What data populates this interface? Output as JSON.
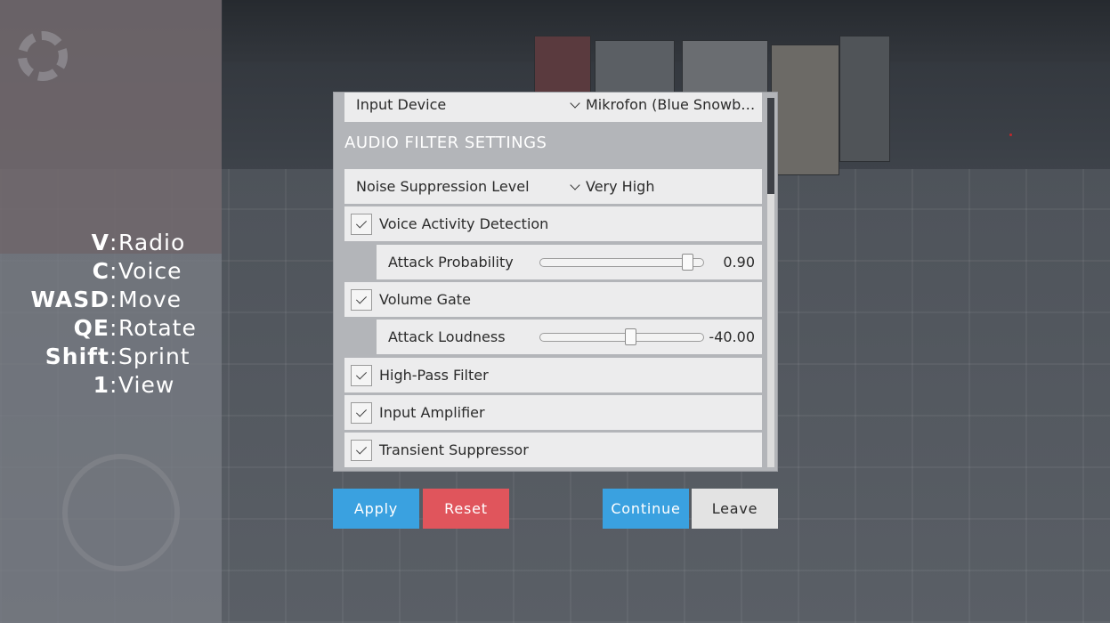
{
  "keybinds": [
    {
      "key": "V",
      "action": "Radio"
    },
    {
      "key": "C",
      "action": "Voice"
    },
    {
      "key": "WASD",
      "action": "Move"
    },
    {
      "key": "QE",
      "action": "Rotate"
    },
    {
      "key": "Shift",
      "action": "Sprint"
    },
    {
      "key": "1",
      "action": "View"
    }
  ],
  "settings": {
    "input_device": {
      "label": "Input Device",
      "value": "Mikrofon (Blue Snowb…"
    },
    "section_title": "AUDIO FILTER SETTINGS",
    "noise_suppression": {
      "label": "Noise Suppression Level",
      "value": "Very High"
    },
    "voice_activity_detection": {
      "label": "Voice Activity Detection",
      "checked": true
    },
    "attack_probability": {
      "label": "Attack Probability",
      "value": "0.90",
      "fraction": 0.9
    },
    "volume_gate": {
      "label": "Volume Gate",
      "checked": true
    },
    "attack_loudness": {
      "label": "Attack Loudness",
      "value": "-40.00",
      "fraction": 0.55
    },
    "high_pass_filter": {
      "label": "High-Pass Filter",
      "checked": true
    },
    "input_amplifier": {
      "label": "Input Amplifier",
      "checked": true
    },
    "transient_suppressor": {
      "label": "Transient Suppressor",
      "checked": true
    }
  },
  "buttons": {
    "apply": "Apply",
    "reset": "Reset",
    "continue": "Continue",
    "leave": "Leave"
  },
  "colors": {
    "accent_blue": "#3aa1e0",
    "reset_red": "#e0555c",
    "leave_gray": "#e3e3e3"
  }
}
